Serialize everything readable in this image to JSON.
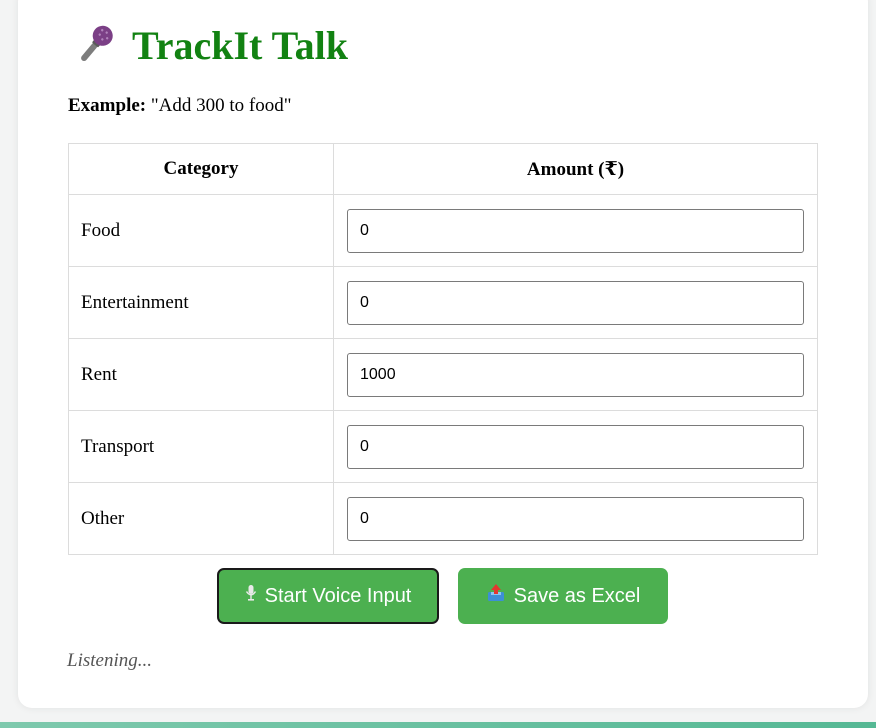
{
  "app": {
    "title": "TrackIt Talk",
    "title_color": "#128212",
    "icon": "microphone-icon"
  },
  "example": {
    "label": "Example:",
    "text": "\"Add 300 to food\""
  },
  "table": {
    "headers": [
      "Category",
      "Amount (₹)"
    ],
    "rows": [
      {
        "category": "Food",
        "amount": "0"
      },
      {
        "category": "Entertainment",
        "amount": "0"
      },
      {
        "category": "Rent",
        "amount": "1000"
      },
      {
        "category": "Transport",
        "amount": "0"
      },
      {
        "category": "Other",
        "amount": "0"
      }
    ]
  },
  "buttons": {
    "voice": {
      "label": "Start Voice Input",
      "icon": "studio-microphone-icon"
    },
    "save": {
      "label": "Save as Excel",
      "icon": "outbox-tray-icon"
    },
    "color": "#4cb050"
  },
  "status": "Listening..."
}
